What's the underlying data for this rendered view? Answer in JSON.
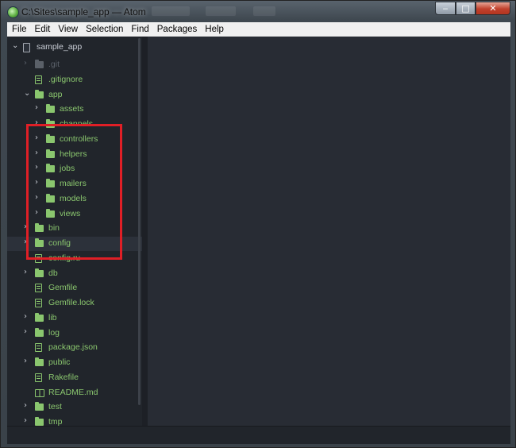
{
  "window": {
    "title": "C:\\Sites\\sample_app — Atom",
    "controls": {
      "minimize": "‒",
      "maximize": "□",
      "close": "✕"
    }
  },
  "menu": [
    "File",
    "Edit",
    "View",
    "Selection",
    "Find",
    "Packages",
    "Help"
  ],
  "tree": {
    "root": "sample_app",
    "items": [
      {
        "name": ".git",
        "type": "folder",
        "depth": 1,
        "expanded": false,
        "dim": true
      },
      {
        "name": ".gitignore",
        "type": "file",
        "depth": 1
      },
      {
        "name": "app",
        "type": "folder",
        "depth": 1,
        "expanded": true
      },
      {
        "name": "assets",
        "type": "folder",
        "depth": 2,
        "expanded": false
      },
      {
        "name": "channels",
        "type": "folder",
        "depth": 2,
        "expanded": false
      },
      {
        "name": "controllers",
        "type": "folder",
        "depth": 2,
        "expanded": false
      },
      {
        "name": "helpers",
        "type": "folder",
        "depth": 2,
        "expanded": false
      },
      {
        "name": "jobs",
        "type": "folder",
        "depth": 2,
        "expanded": false
      },
      {
        "name": "mailers",
        "type": "folder",
        "depth": 2,
        "expanded": false
      },
      {
        "name": "models",
        "type": "folder",
        "depth": 2,
        "expanded": false
      },
      {
        "name": "views",
        "type": "folder",
        "depth": 2,
        "expanded": false
      },
      {
        "name": "bin",
        "type": "folder",
        "depth": 1,
        "expanded": false
      },
      {
        "name": "config",
        "type": "folder",
        "depth": 1,
        "expanded": false,
        "selected": true
      },
      {
        "name": "config.ru",
        "type": "file",
        "depth": 1
      },
      {
        "name": "db",
        "type": "folder",
        "depth": 1,
        "expanded": false
      },
      {
        "name": "Gemfile",
        "type": "file",
        "depth": 1
      },
      {
        "name": "Gemfile.lock",
        "type": "file",
        "depth": 1
      },
      {
        "name": "lib",
        "type": "folder",
        "depth": 1,
        "expanded": false
      },
      {
        "name": "log",
        "type": "folder",
        "depth": 1,
        "expanded": false
      },
      {
        "name": "package.json",
        "type": "file",
        "depth": 1
      },
      {
        "name": "public",
        "type": "folder",
        "depth": 1,
        "expanded": false
      },
      {
        "name": "Rakefile",
        "type": "file",
        "depth": 1
      },
      {
        "name": "README.md",
        "type": "book",
        "depth": 1
      },
      {
        "name": "test",
        "type": "folder",
        "depth": 1,
        "expanded": false
      },
      {
        "name": "tmp",
        "type": "folder",
        "depth": 1,
        "expanded": false
      }
    ]
  },
  "colors": {
    "accent": "#8ac66e",
    "annotation": "#e01f26",
    "panel": "#21252b",
    "editor": "#282c34"
  }
}
